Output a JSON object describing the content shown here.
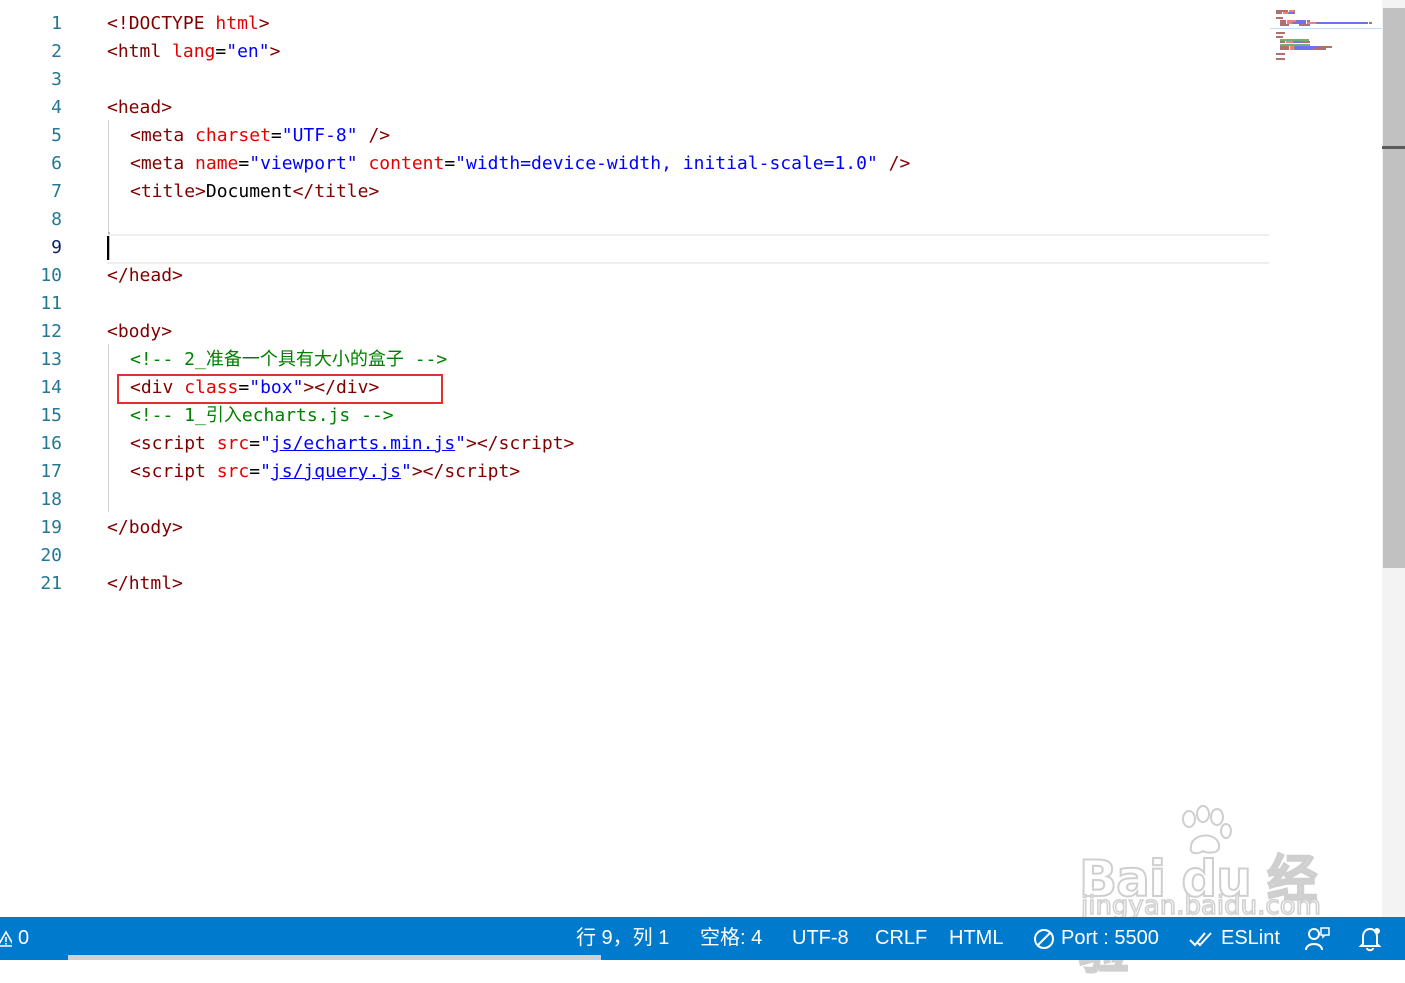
{
  "editor": {
    "lines": [
      {
        "n": "1",
        "tokens": [
          [
            "punct",
            "<!"
          ],
          [
            "tag",
            "DOCTYPE"
          ],
          [
            "text",
            " "
          ],
          [
            "attr",
            "html"
          ],
          [
            "punct",
            ">"
          ]
        ]
      },
      {
        "n": "2",
        "tokens": [
          [
            "punct",
            "<"
          ],
          [
            "tag",
            "html"
          ],
          [
            "text",
            " "
          ],
          [
            "attr",
            "lang"
          ],
          [
            "eq",
            "="
          ],
          [
            "str",
            "\"en\""
          ],
          [
            "punct",
            ">"
          ]
        ]
      },
      {
        "n": "3",
        "tokens": []
      },
      {
        "n": "4",
        "tokens": [
          [
            "punct",
            "<"
          ],
          [
            "tag",
            "head"
          ],
          [
            "punct",
            ">"
          ]
        ]
      },
      {
        "n": "5",
        "indent": true,
        "tokens": [
          [
            "punct",
            "<"
          ],
          [
            "tag",
            "meta"
          ],
          [
            "text",
            " "
          ],
          [
            "attr",
            "charset"
          ],
          [
            "eq",
            "="
          ],
          [
            "str",
            "\"UTF-8\""
          ],
          [
            "text",
            " "
          ],
          [
            "punct",
            "/>"
          ]
        ]
      },
      {
        "n": "6",
        "indent": true,
        "tokens": [
          [
            "punct",
            "<"
          ],
          [
            "tag",
            "meta"
          ],
          [
            "text",
            " "
          ],
          [
            "attr",
            "name"
          ],
          [
            "eq",
            "="
          ],
          [
            "str",
            "\"viewport\""
          ],
          [
            "text",
            " "
          ],
          [
            "attr",
            "content"
          ],
          [
            "eq",
            "="
          ],
          [
            "str",
            "\"width=device-width, initial-scale=1.0\""
          ],
          [
            "text",
            " "
          ],
          [
            "punct",
            "/>"
          ]
        ]
      },
      {
        "n": "7",
        "indent": true,
        "tokens": [
          [
            "punct",
            "<"
          ],
          [
            "tag",
            "title"
          ],
          [
            "punct",
            ">"
          ],
          [
            "text",
            "Document"
          ],
          [
            "punct",
            "</"
          ],
          [
            "tag",
            "title"
          ],
          [
            "punct",
            ">"
          ]
        ]
      },
      {
        "n": "8",
        "tokens": []
      },
      {
        "n": "9",
        "tokens": [],
        "active": true
      },
      {
        "n": "10",
        "tokens": [
          [
            "punct",
            "</"
          ],
          [
            "tag",
            "head"
          ],
          [
            "punct",
            ">"
          ]
        ]
      },
      {
        "n": "11",
        "tokens": []
      },
      {
        "n": "12",
        "tokens": [
          [
            "punct",
            "<"
          ],
          [
            "tag",
            "body"
          ],
          [
            "punct",
            ">"
          ]
        ]
      },
      {
        "n": "13",
        "indent": true,
        "tokens": [
          [
            "comment",
            "<!-- 2_准备一个具有大小的盒子 -->"
          ]
        ]
      },
      {
        "n": "14",
        "indent": true,
        "tokens": [
          [
            "punct",
            "<"
          ],
          [
            "tag",
            "div"
          ],
          [
            "text",
            " "
          ],
          [
            "attr",
            "class"
          ],
          [
            "eq",
            "="
          ],
          [
            "str",
            "\"box\""
          ],
          [
            "punct",
            "></"
          ],
          [
            "tag",
            "div"
          ],
          [
            "punct",
            ">"
          ]
        ]
      },
      {
        "n": "15",
        "indent": true,
        "tokens": [
          [
            "comment",
            "<!-- 1_引入echarts.js -->"
          ]
        ]
      },
      {
        "n": "16",
        "indent": true,
        "tokens": [
          [
            "punct",
            "<"
          ],
          [
            "tag",
            "script"
          ],
          [
            "text",
            " "
          ],
          [
            "attr",
            "src"
          ],
          [
            "eq",
            "="
          ],
          [
            "str",
            "\""
          ],
          [
            "link",
            "js/echarts.min.js"
          ],
          [
            "str",
            "\""
          ],
          [
            "punct",
            "></"
          ],
          [
            "tag",
            "script"
          ],
          [
            "punct",
            ">"
          ]
        ]
      },
      {
        "n": "17",
        "indent": true,
        "tokens": [
          [
            "punct",
            "<"
          ],
          [
            "tag",
            "script"
          ],
          [
            "text",
            " "
          ],
          [
            "attr",
            "src"
          ],
          [
            "eq",
            "="
          ],
          [
            "str",
            "\""
          ],
          [
            "link",
            "js/jquery.js"
          ],
          [
            "str",
            "\""
          ],
          [
            "punct",
            "></"
          ],
          [
            "tag",
            "script"
          ],
          [
            "punct",
            ">"
          ]
        ]
      },
      {
        "n": "18",
        "tokens": []
      },
      {
        "n": "19",
        "tokens": [
          [
            "punct",
            "</"
          ],
          [
            "tag",
            "body"
          ],
          [
            "punct",
            ">"
          ]
        ]
      },
      {
        "n": "20",
        "tokens": []
      },
      {
        "n": "21",
        "tokens": [
          [
            "punct",
            "</"
          ],
          [
            "tag",
            "html"
          ],
          [
            "punct",
            ">"
          ]
        ]
      }
    ]
  },
  "statusbar": {
    "warnings": "0",
    "position": "行 9，列 1",
    "indent": "空格: 4",
    "encoding": "UTF-8",
    "eol": "CRLF",
    "language": "HTML",
    "port": "Port : 5500",
    "eslint": "ESLint"
  },
  "watermark": {
    "brand": "Bai du 经验",
    "url": "jingyan.baidu.com"
  },
  "colors": {
    "status_bar": "#007acc",
    "line_number": "#237893",
    "tag": "#800000",
    "attribute": "#e50000",
    "string": "#0000ff",
    "comment": "#008000",
    "highlight_box": "#e03030"
  }
}
